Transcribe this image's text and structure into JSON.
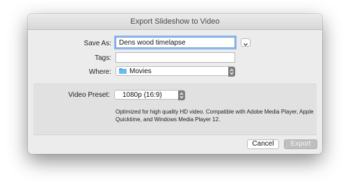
{
  "window": {
    "title": "Export Slideshow to Video"
  },
  "form": {
    "save_as_label": "Save As:",
    "save_as_value": "Dens wood timelapse",
    "tags_label": "Tags:",
    "tags_value": "",
    "where_label": "Where:",
    "where_value": "Movies",
    "where_icon": "folder-icon"
  },
  "preset": {
    "label": "Video Preset:",
    "value": "1080p (16:9)",
    "description": "Optimized for high quality HD video. Compatible with Adobe Media Player, Apple Quicktime, and Windows Media Player 12."
  },
  "buttons": {
    "cancel": "Cancel",
    "export": "Export",
    "export_enabled": false
  },
  "colors": {
    "folder": "#4aa3df",
    "focus_ring": "#8fb8ec"
  }
}
